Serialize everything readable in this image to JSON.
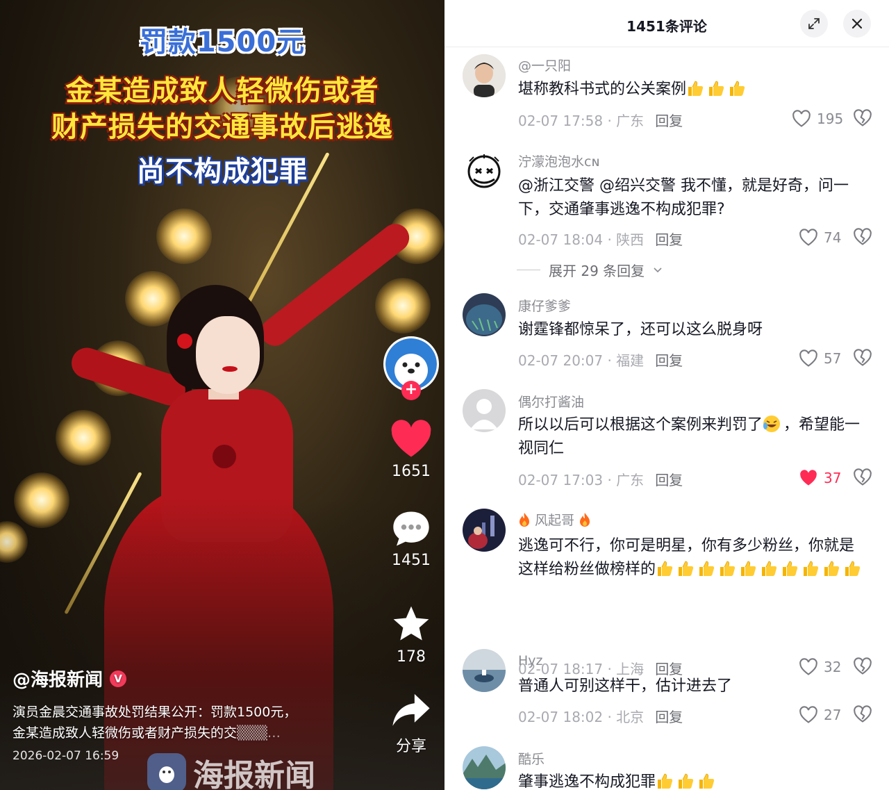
{
  "video": {
    "headline": {
      "line1": "罚款1500元",
      "line2": "金某造成致人轻微伤或者",
      "line3": "财产损失的交通事故后逃逸",
      "line4": "尚不构成犯罪"
    },
    "author": "@海报新闻",
    "verified_badge": "V",
    "description_line1": "演员金晨交通事故处罚结果公开：罚款1500元，",
    "description_line2": "金某造成致人轻微伤或者财产损失的交",
    "date": "2026-02-07 16:59",
    "watermark": "海报新闻",
    "follow_plus": "+",
    "likes": "1651",
    "comments": "1451",
    "favorites": "178",
    "share_label": "分享",
    "colors": {
      "like": "#fe2c55",
      "headline_yellow": "#ffe63c",
      "headline_blue": "#3a6fd8"
    }
  },
  "panel": {
    "title": "1451条评论",
    "expand_icon": "expand-icon",
    "close_icon": "close-icon"
  },
  "comments": [
    {
      "user": "@一只阳",
      "text": "堪称教科书式的公关案例",
      "emoji": [
        "thumbs-up",
        "thumbs-up",
        "thumbs-up"
      ],
      "time": "02-07 17:58 · 广东",
      "reply": "回复",
      "likes": "195",
      "liked": false
    },
    {
      "user": "泞濛泡泡水ᴄɴ",
      "text": "@浙江交警 @绍兴交警 我不懂，就是好奇，问一下，交通肇事逃逸不构成犯罪?",
      "time": "02-07 18:04 · 陕西",
      "reply": "回复",
      "likes": "74",
      "liked": false,
      "expand": "展开 29 条回复"
    },
    {
      "user": "康仔爹爹",
      "text": "谢霆锋都惊呆了，还可以这么脱身呀",
      "time": "02-07 20:07 · 福建",
      "reply": "回复",
      "likes": "57",
      "liked": false
    },
    {
      "user": "偶尔打酱油",
      "text_before": "所以以后可以根据这个案例来判罚了",
      "text_after": "，希望能一视同仁",
      "time": "02-07 17:03 · 广东",
      "reply": "回复",
      "likes": "37",
      "liked": true
    },
    {
      "user": "风起哥",
      "text": "逃逸可不行，你可是明星，你有多少粉丝，你就是这样给粉丝做榜样的",
      "emoji_count": 10,
      "time": "02-07 18:17 · 上海",
      "reply": "回复",
      "likes": "32",
      "liked": false
    },
    {
      "user": "Hyz",
      "text": "普通人可别这样干，估计进去了",
      "time": "02-07 18:02 · 北京",
      "reply": "回复",
      "likes": "27",
      "liked": false
    },
    {
      "user": "酷乐",
      "text": "肇事逃逸不构成犯罪",
      "emoji": [
        "thumbs-up",
        "thumbs-up",
        "thumbs-up"
      ]
    }
  ]
}
